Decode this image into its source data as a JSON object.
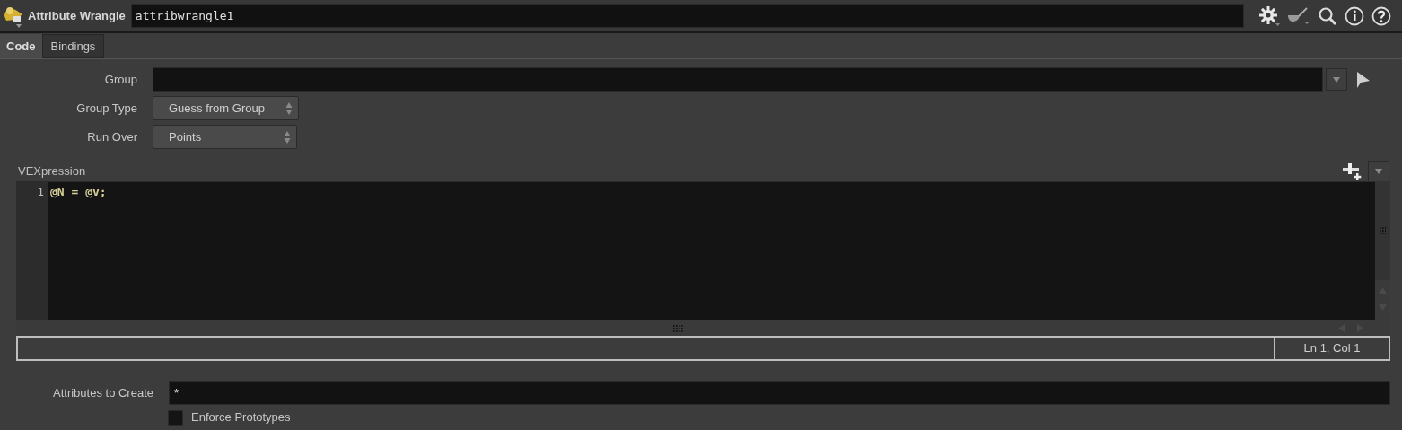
{
  "header": {
    "node_type": "Attribute Wrangle",
    "node_name": "attribwrangle1"
  },
  "tabs": [
    {
      "label": "Code",
      "selected": true
    },
    {
      "label": "Bindings",
      "selected": false
    }
  ],
  "group": {
    "label": "Group"
  },
  "group_type": {
    "label": "Group Type",
    "value": "Guess from Group"
  },
  "run_over": {
    "label": "Run Over",
    "value": "Points"
  },
  "vexpression": {
    "label": "VEXpression",
    "lines": [
      {
        "number": "1",
        "code": "@N = @v;"
      }
    ],
    "status": "Ln 1, Col 1"
  },
  "attributes_to_create": {
    "label": "Attributes to Create",
    "value": "*"
  },
  "enforce_prototypes": {
    "label": "Enforce Prototypes",
    "checked": false
  }
}
